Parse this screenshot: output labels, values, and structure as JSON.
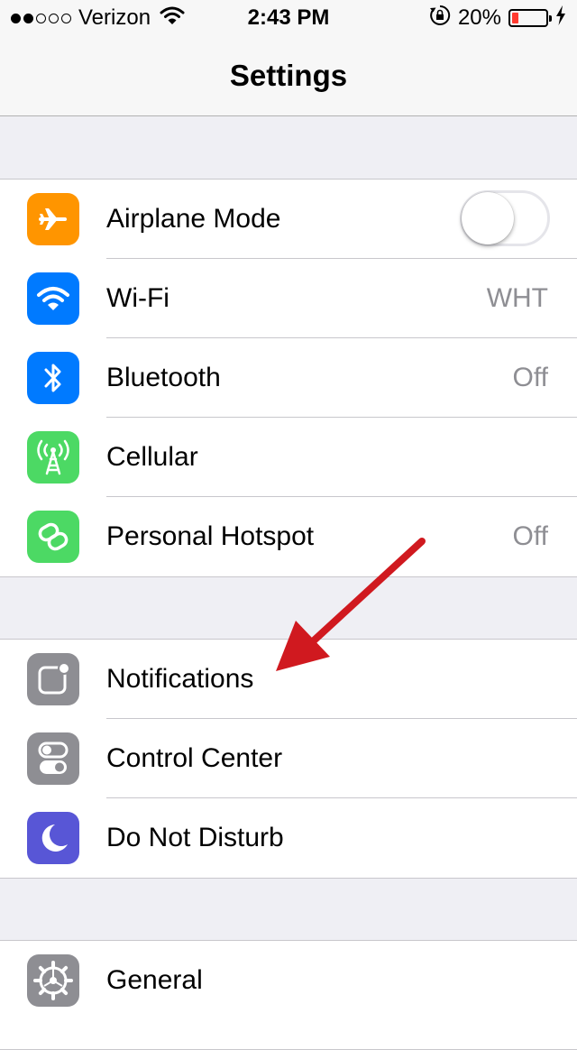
{
  "status_bar": {
    "carrier": "Verizon",
    "signal_bars_filled": 2,
    "signal_bars_total": 5,
    "time": "2:43 PM",
    "battery_percent_text": "20%",
    "battery_level": 0.2,
    "icons": [
      "wifi-icon",
      "rotation-lock-icon",
      "battery-icon",
      "charging-bolt-icon"
    ]
  },
  "nav": {
    "title": "Settings"
  },
  "groups": [
    {
      "rows": [
        {
          "label": "Airplane Mode",
          "icon": "airplane-icon",
          "icon_color": "#ff9500",
          "control": "toggle",
          "toggle_on": false
        },
        {
          "label": "Wi-Fi",
          "icon": "wifi-icon",
          "icon_color": "#007aff",
          "value": "WHT"
        },
        {
          "label": "Bluetooth",
          "icon": "bluetooth-icon",
          "icon_color": "#007aff",
          "value": "Off"
        },
        {
          "label": "Cellular",
          "icon": "cellular-antenna-icon",
          "icon_color": "#4cd964"
        },
        {
          "label": "Personal Hotspot",
          "icon": "hotspot-link-icon",
          "icon_color": "#4cd964",
          "value": "Off"
        }
      ]
    },
    {
      "rows": [
        {
          "label": "Notifications",
          "icon": "notifications-icon",
          "icon_color": "#8e8e93"
        },
        {
          "label": "Control Center",
          "icon": "control-center-icon",
          "icon_color": "#8e8e93"
        },
        {
          "label": "Do Not Disturb",
          "icon": "moon-icon",
          "icon_color": "#5856d6"
        }
      ]
    },
    {
      "rows": [
        {
          "label": "General",
          "icon": "gear-icon",
          "icon_color": "#8e8e93"
        }
      ]
    }
  ],
  "colors": {
    "background": "#efeff4",
    "separator": "#c8c7cc",
    "value_text": "#8e8e93",
    "annotation_arrow": "#d0191f",
    "battery_low": "#ff3b30"
  },
  "annotation": {
    "icon": "red-arrow-icon",
    "points_to": "Notifications"
  }
}
